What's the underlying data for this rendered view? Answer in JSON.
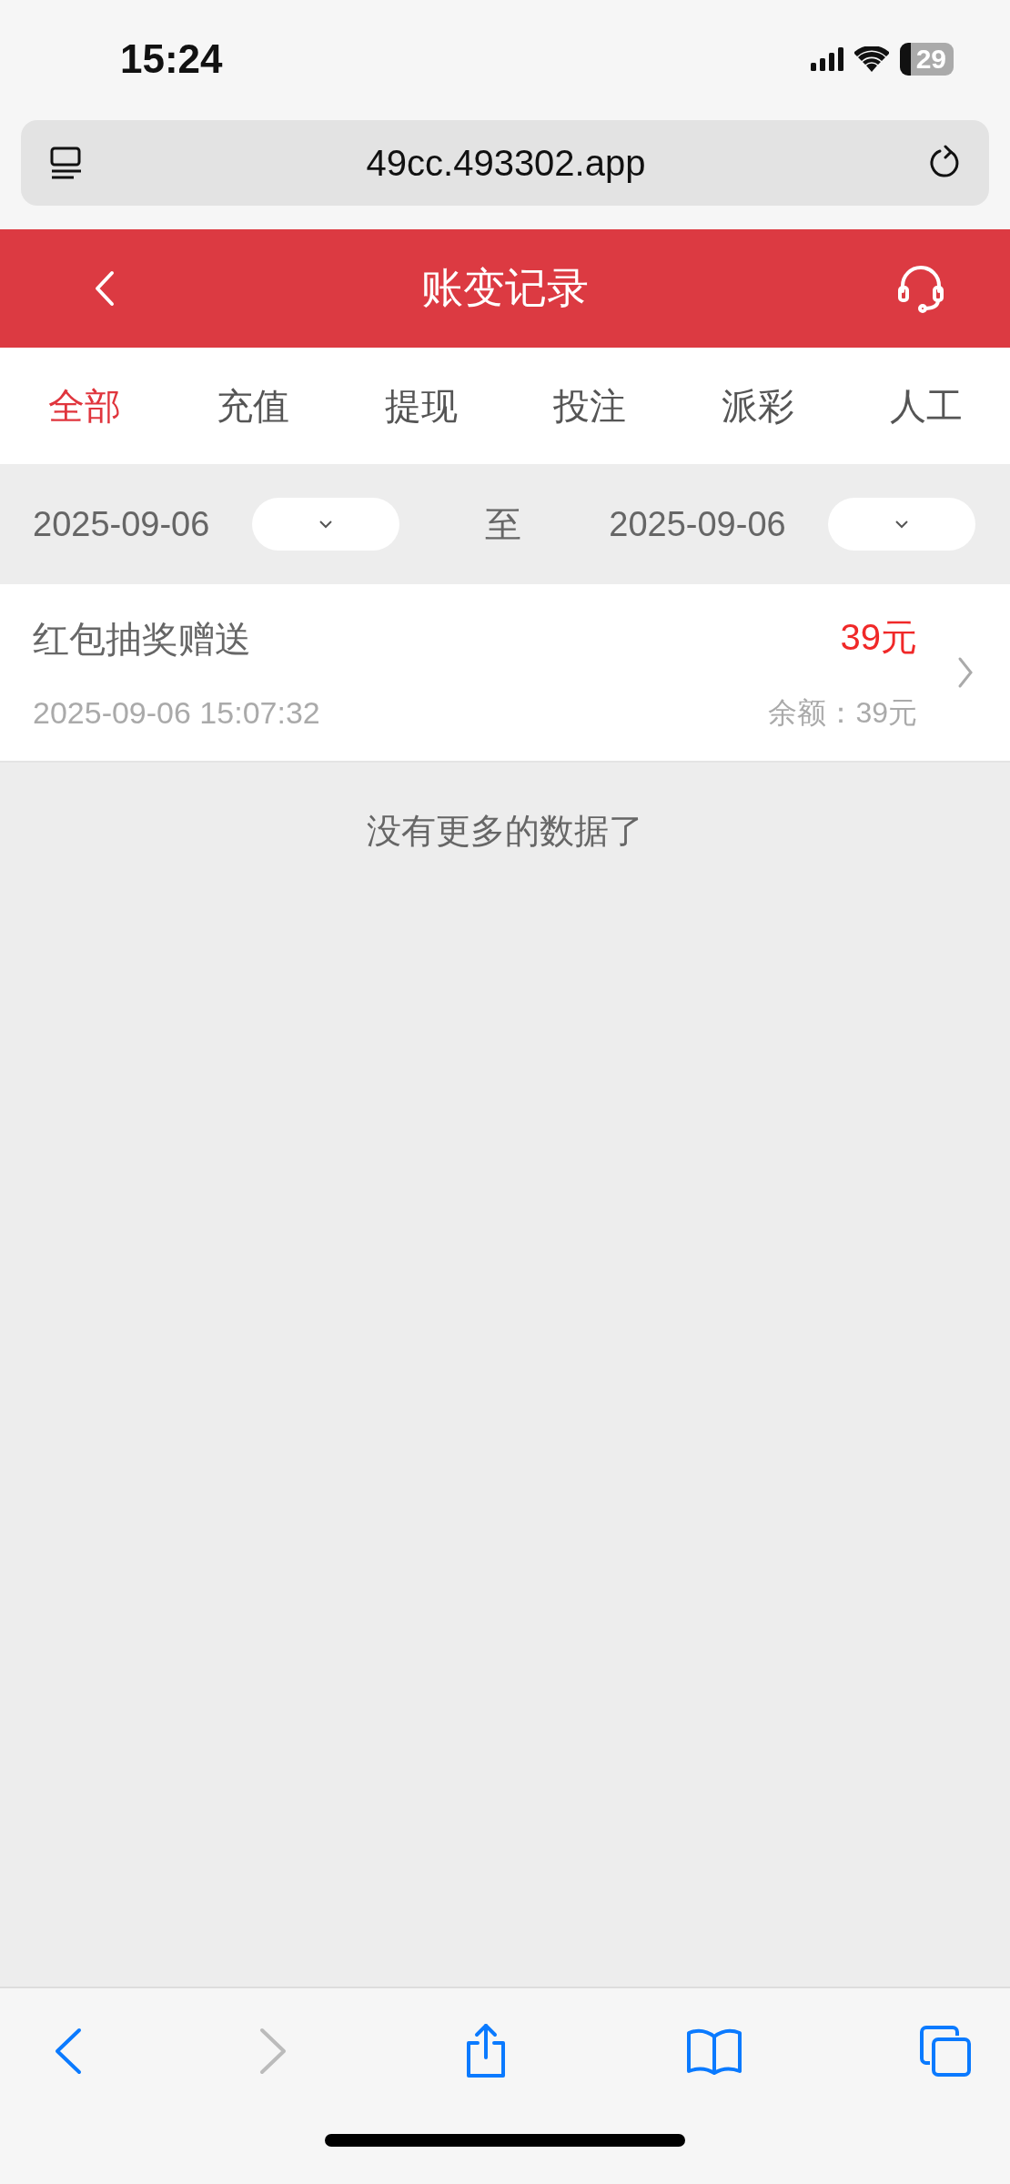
{
  "status_bar": {
    "time": "15:24",
    "battery": "29"
  },
  "browser": {
    "url": "49cc.493302.app"
  },
  "header": {
    "title": "账变记录"
  },
  "tabs": [
    {
      "label": "全部",
      "selected": true
    },
    {
      "label": "充值",
      "selected": false
    },
    {
      "label": "提现",
      "selected": false
    },
    {
      "label": "投注",
      "selected": false
    },
    {
      "label": "派彩",
      "selected": false
    },
    {
      "label": "人工",
      "selected": false
    }
  ],
  "date_filter": {
    "start": "2025-09-06",
    "separator": "至",
    "end": "2025-09-06"
  },
  "records": [
    {
      "title": "红包抽奖赠送",
      "time": "2025-09-06 15:07:32",
      "amount": "39元",
      "balance": "余额：39元"
    }
  ],
  "end_message": "没有更多的数据了",
  "toolbar": {
    "back_disabled": false,
    "forward_disabled": true
  }
}
